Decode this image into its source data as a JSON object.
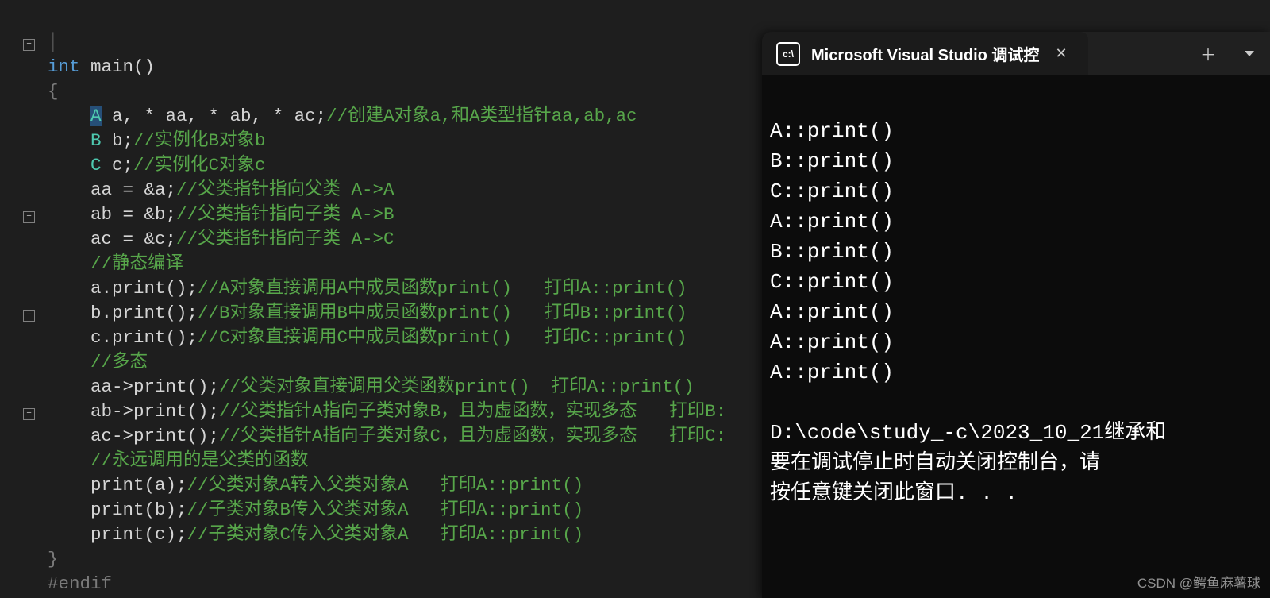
{
  "editor": {
    "func_sig": {
      "kw": "int",
      "name": "main",
      "parens": "()"
    },
    "lines": {
      "l1": {
        "pre": "    ",
        "type": "A",
        "rest": " a, * aa, * ab, * ac;",
        "com": "//创建A对象a,和A类型指针aa,ab,ac"
      },
      "l2": {
        "pre": "    ",
        "type": "B",
        "rest": " b;",
        "com": "//实例化B对象b"
      },
      "l3": {
        "pre": "    ",
        "type": "C",
        "rest": " c;",
        "com": "//实例化C对象c"
      },
      "l4": {
        "pre": "    aa = &a;",
        "com": "//父类指针指向父类 A->A"
      },
      "l5": {
        "pre": "    ab = &b;",
        "com": "//父类指针指向子类 A->B"
      },
      "l6": {
        "pre": "    ac = &c;",
        "com": "//父类指针指向子类 A->C"
      },
      "l7": {
        "pre": "    ",
        "com": "//静态编译"
      },
      "l8": {
        "pre": "    a.print();",
        "com": "//A对象直接调用A中成员函数print()   打印A::print()"
      },
      "l9": {
        "pre": "    b.print();",
        "com": "//B对象直接调用B中成员函数print()   打印B::print()"
      },
      "l10": {
        "pre": "    c.print();",
        "com": "//C对象直接调用C中成员函数print()   打印C::print()"
      },
      "l11": {
        "pre": "    ",
        "com": "//多态"
      },
      "l12": {
        "pre": "    aa->print();",
        "com": "//父类对象直接调用父类函数print()  打印A::print()"
      },
      "l13": {
        "pre": "    ab->print();",
        "com": "//父类指针A指向子类对象B，且为虚函数，实现多态   打印B:"
      },
      "l14": {
        "pre": "    ac->print();",
        "com": "//父类指针A指向子类对象C，且为虚函数，实现多态   打印C:"
      },
      "l15": {
        "pre": "    ",
        "com": "//永远调用的是父类的函数"
      },
      "l16": {
        "pre": "    print(a);",
        "com": "//父类对象A转入父类对象A   打印A::print()"
      },
      "l17": {
        "pre": "    print(b);",
        "com": "//子类对象B传入父类对象A   打印A::print()"
      },
      "l18": {
        "pre": "    print(c);",
        "com": "//子类对象C传入父类对象A   打印A::print()"
      }
    },
    "brace_open": "{",
    "brace_close": "}",
    "endif": "#endif"
  },
  "terminal": {
    "tab_title": "Microsoft Visual Studio 调试控",
    "output": [
      "A::print()",
      "B::print()",
      "C::print()",
      "A::print()",
      "B::print()",
      "C::print()",
      "A::print()",
      "A::print()",
      "A::print()",
      "",
      "D:\\code\\study_-c\\2023_10_21继承和",
      "要在调试停止时自动关闭控制台，请",
      "按任意键关闭此窗口. . ."
    ]
  },
  "watermark": "CSDN @鳄鱼麻薯球"
}
